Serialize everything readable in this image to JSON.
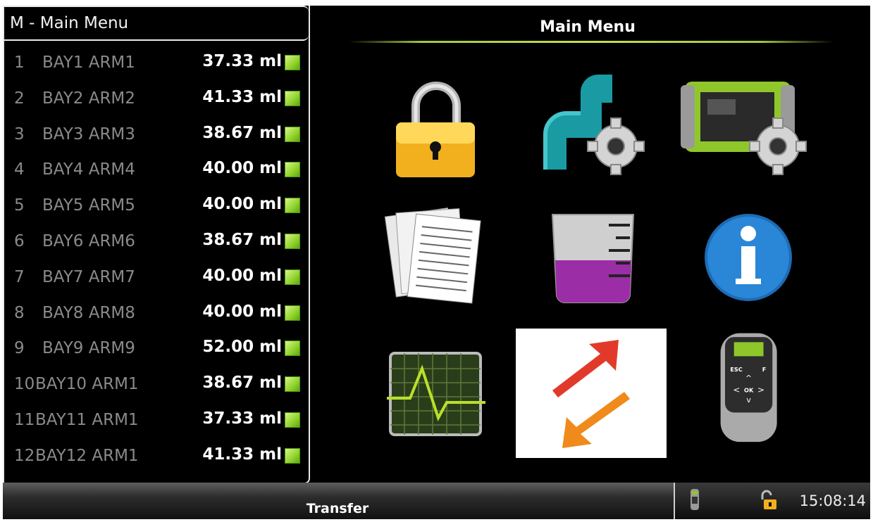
{
  "window": {
    "menu_header": "M - Main Menu",
    "title": "Main Menu"
  },
  "bays": [
    {
      "num": "1",
      "name": "BAY1 ARM1",
      "volume": "37.33 ml",
      "status_color": "#8fd22a"
    },
    {
      "num": "2",
      "name": "BAY2 ARM2",
      "volume": "41.33 ml",
      "status_color": "#8fd22a"
    },
    {
      "num": "3",
      "name": "BAY3 ARM3",
      "volume": "38.67 ml",
      "status_color": "#8fd22a"
    },
    {
      "num": "4",
      "name": "BAY4 ARM4",
      "volume": "40.00 ml",
      "status_color": "#8fd22a"
    },
    {
      "num": "5",
      "name": "BAY5 ARM5",
      "volume": "40.00 ml",
      "status_color": "#8fd22a"
    },
    {
      "num": "6",
      "name": "BAY6 ARM6",
      "volume": "38.67 ml",
      "status_color": "#8fd22a"
    },
    {
      "num": "7",
      "name": "BAY7 ARM7",
      "volume": "40.00 ml",
      "status_color": "#8fd22a"
    },
    {
      "num": "8",
      "name": "BAY8 ARM8",
      "volume": "40.00 ml",
      "status_color": "#8fd22a"
    },
    {
      "num": "9",
      "name": "BAY9 ARM9",
      "volume": "52.00 ml",
      "status_color": "#8fd22a"
    },
    {
      "num": "10",
      "name": "BAY10 ARM1",
      "volume": "38.67 ml",
      "status_color": "#8fd22a"
    },
    {
      "num": "11",
      "name": "BAY11 ARM1",
      "volume": "37.33 ml",
      "status_color": "#8fd22a"
    },
    {
      "num": "12",
      "name": "BAY12 ARM1",
      "volume": "41.33 ml",
      "status_color": "#8fd22a"
    }
  ],
  "menu_tiles": [
    {
      "icon": "lock-icon"
    },
    {
      "icon": "pipe-settings-icon"
    },
    {
      "icon": "device-settings-icon"
    },
    {
      "icon": "documents-icon"
    },
    {
      "icon": "beaker-icon"
    },
    {
      "icon": "info-icon"
    },
    {
      "icon": "graph-monitor-icon"
    },
    {
      "icon": "transfer-arrows-icon",
      "selected": true
    },
    {
      "icon": "remote-keypad-icon"
    }
  ],
  "bottom_bar": {
    "selected_label": "Transfer",
    "clock": "15:08:14"
  },
  "colors": {
    "accent_green": "#a3c83a",
    "background": "#000000"
  }
}
